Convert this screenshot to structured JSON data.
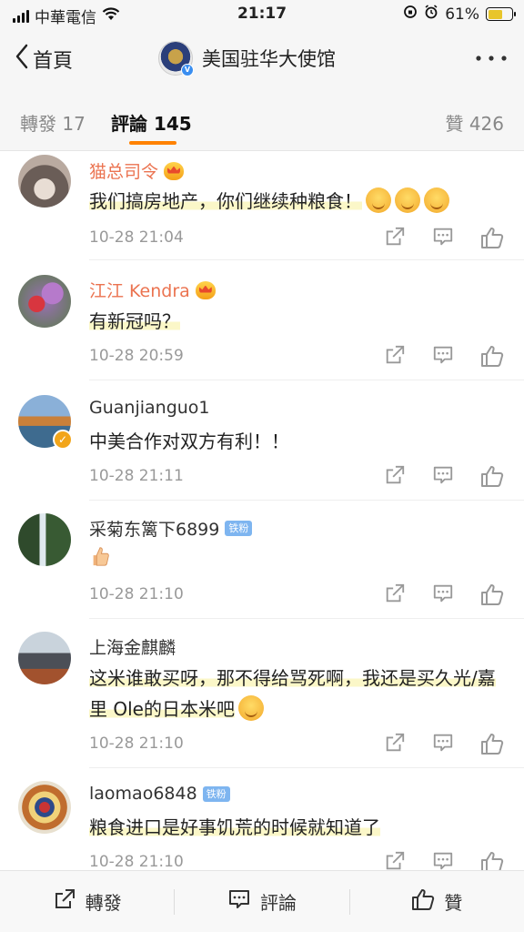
{
  "status_bar": {
    "carrier": "中華電信",
    "time": "21:17",
    "battery": "61%",
    "battery_level": 0.61
  },
  "nav": {
    "back_label": "首頁",
    "title": "美国驻华大使馆"
  },
  "tabs": {
    "repost": "轉發 17",
    "comments": "評論 145",
    "likes": "贊 426"
  },
  "comments": [
    {
      "name": "猫总司令",
      "text": "我们搞房地产，你们继续种粮食！",
      "time": "10-28 21:04"
    },
    {
      "name": "江江 Kendra",
      "text": "有新冠吗？",
      "time": "10-28 20:59"
    },
    {
      "name": "Guanjianguo1",
      "text": "中美合作对双方有利！！",
      "time": "10-28 21:11"
    },
    {
      "name": "采菊东篱下6899",
      "badge": "铁粉",
      "text": "",
      "time": "10-28 21:10"
    },
    {
      "name": "上海金麒麟",
      "text": "这米谁敢买呀，那不得给骂死啊，我还是买久光/嘉里 Ole的日本米吧",
      "time": "10-28 21:10"
    },
    {
      "name": "laomao6848",
      "badge": "铁粉",
      "text": "粮食进口是好事饥荒的时候就知道了",
      "time": "10-28 21:10"
    }
  ],
  "bottom_bar": {
    "repost": "轉發",
    "comment": "評論",
    "like": "贊"
  },
  "colors": {
    "accent": "#ff8200",
    "vip_name": "#eb7350",
    "fan_badge": "#7eb5f0"
  }
}
